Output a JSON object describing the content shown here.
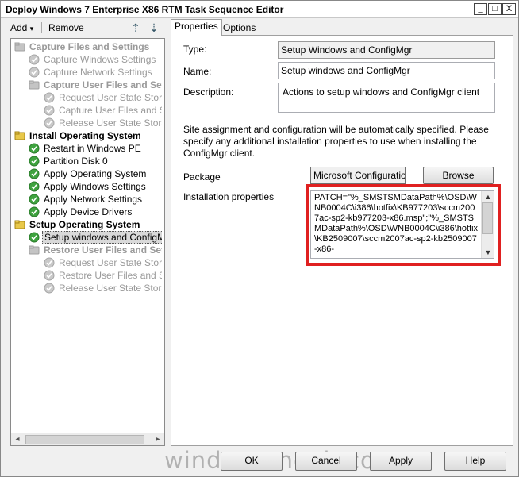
{
  "window": {
    "title": "Deploy Windows 7 Enterprise X86 RTM Task Sequence Editor",
    "controls": {
      "minimize": "_",
      "maximize": "□",
      "close": "X"
    }
  },
  "toolbar": {
    "add_label": "Add",
    "add_arrow": "▾",
    "remove_label": "Remove",
    "icon1": "move-up-icon",
    "icon2": "move-down-icon"
  },
  "tree": {
    "items": [
      {
        "label": "Capture Files and Settings",
        "level": 0,
        "kind": "group",
        "state": "disabled"
      },
      {
        "label": "Capture Windows Settings",
        "level": 1,
        "kind": "step",
        "state": "disabled"
      },
      {
        "label": "Capture Network Settings",
        "level": 1,
        "kind": "step",
        "state": "disabled"
      },
      {
        "label": "Capture User Files and Settings",
        "level": 1,
        "kind": "group",
        "state": "disabled"
      },
      {
        "label": "Request User State Storage",
        "level": 2,
        "kind": "step",
        "state": "disabled"
      },
      {
        "label": "Capture User Files and Settings",
        "level": 2,
        "kind": "step",
        "state": "disabled"
      },
      {
        "label": "Release User State Storage",
        "level": 2,
        "kind": "step",
        "state": "disabled"
      },
      {
        "label": "Install Operating System",
        "level": 0,
        "kind": "group",
        "state": "enabled"
      },
      {
        "label": "Restart in Windows PE",
        "level": 1,
        "kind": "step",
        "state": "enabled"
      },
      {
        "label": "Partition Disk 0",
        "level": 1,
        "kind": "step",
        "state": "enabled"
      },
      {
        "label": "Apply Operating System",
        "level": 1,
        "kind": "step",
        "state": "enabled"
      },
      {
        "label": "Apply Windows Settings",
        "level": 1,
        "kind": "step",
        "state": "enabled"
      },
      {
        "label": "Apply Network Settings",
        "level": 1,
        "kind": "step",
        "state": "enabled"
      },
      {
        "label": "Apply Device Drivers",
        "level": 1,
        "kind": "step",
        "state": "enabled"
      },
      {
        "label": "Setup Operating System",
        "level": 0,
        "kind": "group",
        "state": "enabled"
      },
      {
        "label": "Setup windows and ConfigMgr",
        "level": 1,
        "kind": "step",
        "state": "selected"
      },
      {
        "label": "Restore User Files and Settings",
        "level": 1,
        "kind": "group",
        "state": "disabled"
      },
      {
        "label": "Request User State Storage",
        "level": 2,
        "kind": "step",
        "state": "disabled"
      },
      {
        "label": "Restore User Files and Settings",
        "level": 2,
        "kind": "step",
        "state": "disabled"
      },
      {
        "label": "Release User State Storage",
        "level": 2,
        "kind": "step",
        "state": "disabled"
      }
    ],
    "scroll_left": "◂",
    "scroll_right": "▸"
  },
  "tabs": [
    {
      "label": "Properties",
      "active": true
    },
    {
      "label": "Options",
      "active": false
    }
  ],
  "properties": {
    "type_label": "Type:",
    "type_value": "Setup Windows and ConfigMgr",
    "name_label": "Name:",
    "name_value": "Setup windows and ConfigMgr",
    "description_label": "Description:",
    "description_value": "Actions to setup windows and ConfigMgr client",
    "note": "Site assignment and configuration will be automatically specified. Please specify any additional installation properties to use when installing the ConfigMgr client.",
    "package_label": "Package",
    "package_value": "Microsoft Configuration",
    "browse_label": "Browse",
    "install_props_label": "Installation properties",
    "install_props_value": "PATCH=\"%_SMSTSMDataPath%\\OSD\\WNB0004C\\i386\\hotfix\\KB977203\\sccm2007ac-sp2-kb977203-x86.msp\";\"%_SMSTSMDataPath%\\OSD\\WNB0004C\\i386\\hotfix\\KB2509007\\sccm2007ac-sp2-kb2509007-x86-",
    "scroll_up": "▲",
    "scroll_down": "▼"
  },
  "highlight_color": "#e02020",
  "buttons": {
    "ok": "OK",
    "cancel": "Cancel",
    "apply": "Apply",
    "help": "Help"
  },
  "watermark": "windows-noob.com"
}
